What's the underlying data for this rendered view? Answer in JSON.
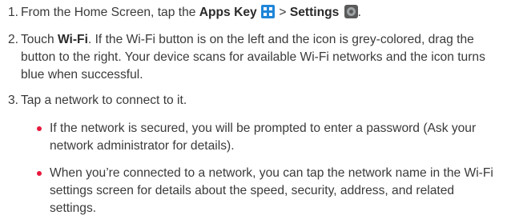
{
  "steps": [
    {
      "number": "1.",
      "prefix": "From the Home Screen, tap the ",
      "apps_key": "Apps Key",
      "separator": " > ",
      "settings": "Settings",
      "apps_icon": "apps-grid-icon",
      "settings_icon": "settings-gear-icon"
    },
    {
      "number": "2.",
      "touch": "Touch ",
      "wifi": "Wi-Fi",
      "rest": ". If the Wi-Fi button is on the left and the icon is grey-colored, drag the button to the right. Your device scans for available Wi-Fi networks and the icon turns blue when successful."
    },
    {
      "number": "3.",
      "text": "Tap a network to connect to it."
    }
  ],
  "bullets": [
    "If the network is secured, you will be prompted to enter a password (Ask your network administrator for details).",
    "When you’re connected to a network, you can tap the network name in the Wi-Fi settings screen for details about the speed, security, address, and related settings."
  ],
  "colors": {
    "bullet": "#e8173d",
    "apps_icon": "#1f86d8",
    "text": "#3a3a3a"
  }
}
